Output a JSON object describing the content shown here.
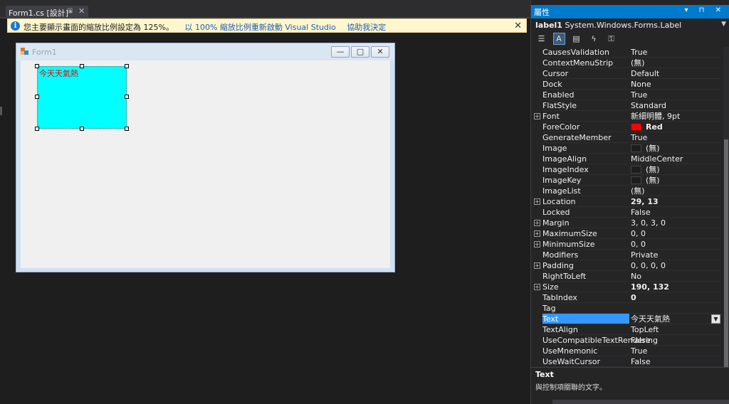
{
  "document": {
    "tab_label": "Form1.cs [設計]*",
    "tab_pin": "⊞",
    "tab_close": "✕"
  },
  "infobar": {
    "icon": "info-icon",
    "message": "您主要顯示畫面的縮放比例設定為 125%。",
    "link_restart": "以 100% 縮放比例重新啟動 Visual Studio",
    "link_help": "協助我決定",
    "close": "✕"
  },
  "form": {
    "title": "Form1",
    "minimize": "—",
    "maximize": "□",
    "close": "✕",
    "label_text": "今天天氣熱",
    "label_back_color": "#00ffff",
    "label_fore_color": "#ff0000"
  },
  "properties": {
    "header_title": "屬性",
    "header_buttons": "▾ ⊓ ✕",
    "object_name": "label1",
    "object_type": "System.Windows.Forms.Label",
    "rows": [
      {
        "name": "CausesValidation",
        "value": "True",
        "expandable": false
      },
      {
        "name": "ContextMenuStrip",
        "value": "(無)",
        "expandable": false
      },
      {
        "name": "Cursor",
        "value": "Default",
        "expandable": false
      },
      {
        "name": "Dock",
        "value": "None",
        "expandable": false
      },
      {
        "name": "Enabled",
        "value": "True",
        "expandable": false
      },
      {
        "name": "FlatStyle",
        "value": "Standard",
        "expandable": false
      },
      {
        "name": "Font",
        "value": "新細明體, 9pt",
        "expandable": true
      },
      {
        "name": "ForeColor",
        "value": "Red",
        "expandable": false,
        "swatch": "red",
        "bold": true
      },
      {
        "name": "GenerateMember",
        "value": "True",
        "expandable": false
      },
      {
        "name": "Image",
        "value": "(無)",
        "expandable": false,
        "swatch": "empty"
      },
      {
        "name": "ImageAlign",
        "value": "MiddleCenter",
        "expandable": false
      },
      {
        "name": "ImageIndex",
        "value": "(無)",
        "expandable": false,
        "swatch": "empty"
      },
      {
        "name": "ImageKey",
        "value": "(無)",
        "expandable": false,
        "swatch": "empty"
      },
      {
        "name": "ImageList",
        "value": "(無)",
        "expandable": false
      },
      {
        "name": "Location",
        "value": "29, 13",
        "expandable": true,
        "bold": true
      },
      {
        "name": "Locked",
        "value": "False",
        "expandable": false
      },
      {
        "name": "Margin",
        "value": "3, 0, 3, 0",
        "expandable": true
      },
      {
        "name": "MaximumSize",
        "value": "0, 0",
        "expandable": true
      },
      {
        "name": "MinimumSize",
        "value": "0, 0",
        "expandable": true
      },
      {
        "name": "Modifiers",
        "value": "Private",
        "expandable": false
      },
      {
        "name": "Padding",
        "value": "0, 0, 0, 0",
        "expandable": true
      },
      {
        "name": "RightToLeft",
        "value": "No",
        "expandable": false
      },
      {
        "name": "Size",
        "value": "190, 132",
        "expandable": true,
        "bold": true
      },
      {
        "name": "TabIndex",
        "value": "0",
        "expandable": false,
        "bold": true
      },
      {
        "name": "Tag",
        "value": "",
        "expandable": false
      },
      {
        "name": "Text",
        "value": "今天天氣熱",
        "expandable": false,
        "selected": true,
        "dropdown": true
      },
      {
        "name": "TextAlign",
        "value": "TopLeft",
        "expandable": false
      },
      {
        "name": "UseCompatibleTextRendering",
        "value": "False",
        "expandable": false
      },
      {
        "name": "UseMnemonic",
        "value": "True",
        "expandable": false
      },
      {
        "name": "UseWaitCursor",
        "value": "False",
        "expandable": false
      }
    ],
    "description_title": "Text",
    "description_text": "與控制項關聯的文字。"
  },
  "colors": {
    "accent": "#007acc",
    "selected_row": "#3399ff"
  }
}
